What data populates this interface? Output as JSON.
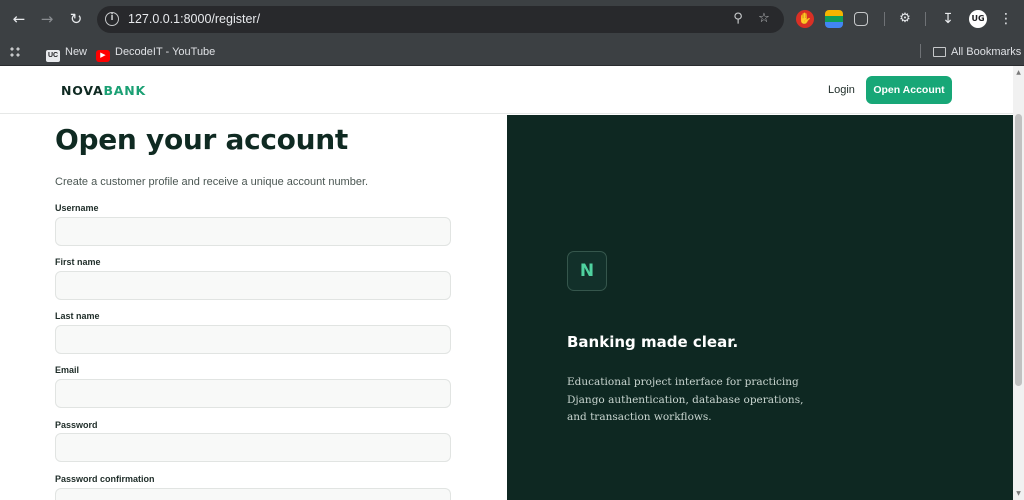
{
  "browser": {
    "url": "127.0.0.1:8000/register/",
    "bookmarks": [
      {
        "label": "New",
        "icon": "uc-icon"
      },
      {
        "label": "DecodeIT - YouTube",
        "icon": "youtube-icon"
      }
    ],
    "all_bookmarks_label": "All Bookmarks",
    "profile_initials": "UG"
  },
  "header": {
    "logo_part1": "NOVA",
    "logo_part2": "BANK",
    "login_label": "Login",
    "open_account_label": "Open Account"
  },
  "form": {
    "title": "Open your account",
    "subtitle": "Create a customer profile and receive a unique account number.",
    "fields": [
      {
        "label": "Username",
        "value": ""
      },
      {
        "label": "First name",
        "value": ""
      },
      {
        "label": "Last name",
        "value": ""
      },
      {
        "label": "Email",
        "value": ""
      },
      {
        "label": "Password",
        "value": ""
      },
      {
        "label": "Password confirmation",
        "value": ""
      }
    ]
  },
  "promo": {
    "badge_letter": "N",
    "title": "Banking made clear.",
    "text": "Educational project interface for practicing Django authentication, database operations, and transaction workflows."
  },
  "colors": {
    "brand_dark": "#0f2a22",
    "brand_green": "#17a777",
    "panel_bg": "#0e2822",
    "badge_letter": "#4fd19f"
  }
}
